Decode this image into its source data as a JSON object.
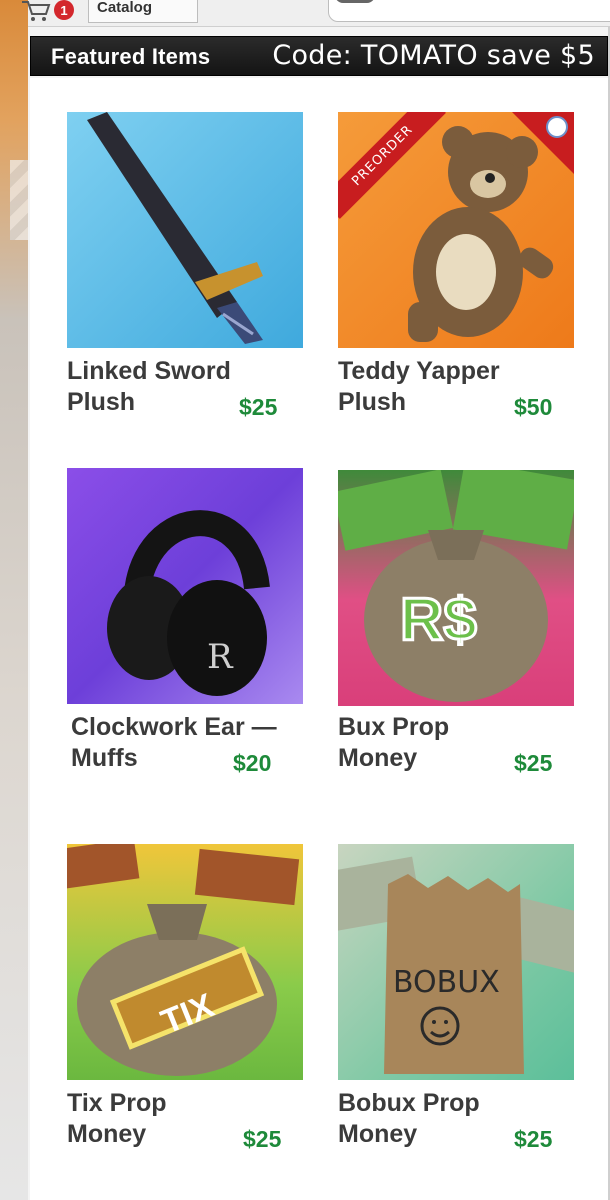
{
  "topbar": {
    "cart_count": "1",
    "catalog_label": "Catalog"
  },
  "header": {
    "title": "Featured Items",
    "promo": "Code: TOMATO save $5"
  },
  "colors": {
    "price_green": "#1e8a3a",
    "header_dark": "#1b1b1b",
    "preorder_red": "#c81d1f",
    "badge_red": "#d3272c"
  },
  "items": [
    {
      "name_line1": "Linked Sword",
      "name_line2": "Plush",
      "price": "$25",
      "badge": "",
      "image": "sword-plush"
    },
    {
      "name_line1": "Teddy Yapper",
      "name_line2": "Plush",
      "price": "$50",
      "badge": "PREORDER",
      "image": "teddy-plush"
    },
    {
      "name_line1": "Clockwork Ear —",
      "name_line2": "Muffs",
      "price": "$20",
      "badge": "",
      "image": "ear-muffs"
    },
    {
      "name_line1": "Bux Prop",
      "name_line2": "Money",
      "price": "$25",
      "badge": "",
      "image": "bux-bag"
    },
    {
      "name_line1": "Tix Prop",
      "name_line2": "Money",
      "price": "$25",
      "badge": "",
      "image": "tix-bag"
    },
    {
      "name_line1": "Bobux Prop",
      "name_line2": "Money",
      "price": "$25",
      "badge": "",
      "image": "bobux-bag"
    }
  ],
  "image_text": {
    "bux_logo": "R$",
    "tix_label": "TIX",
    "bobux_label": "BOBUX",
    "muffs_letter": "R"
  }
}
